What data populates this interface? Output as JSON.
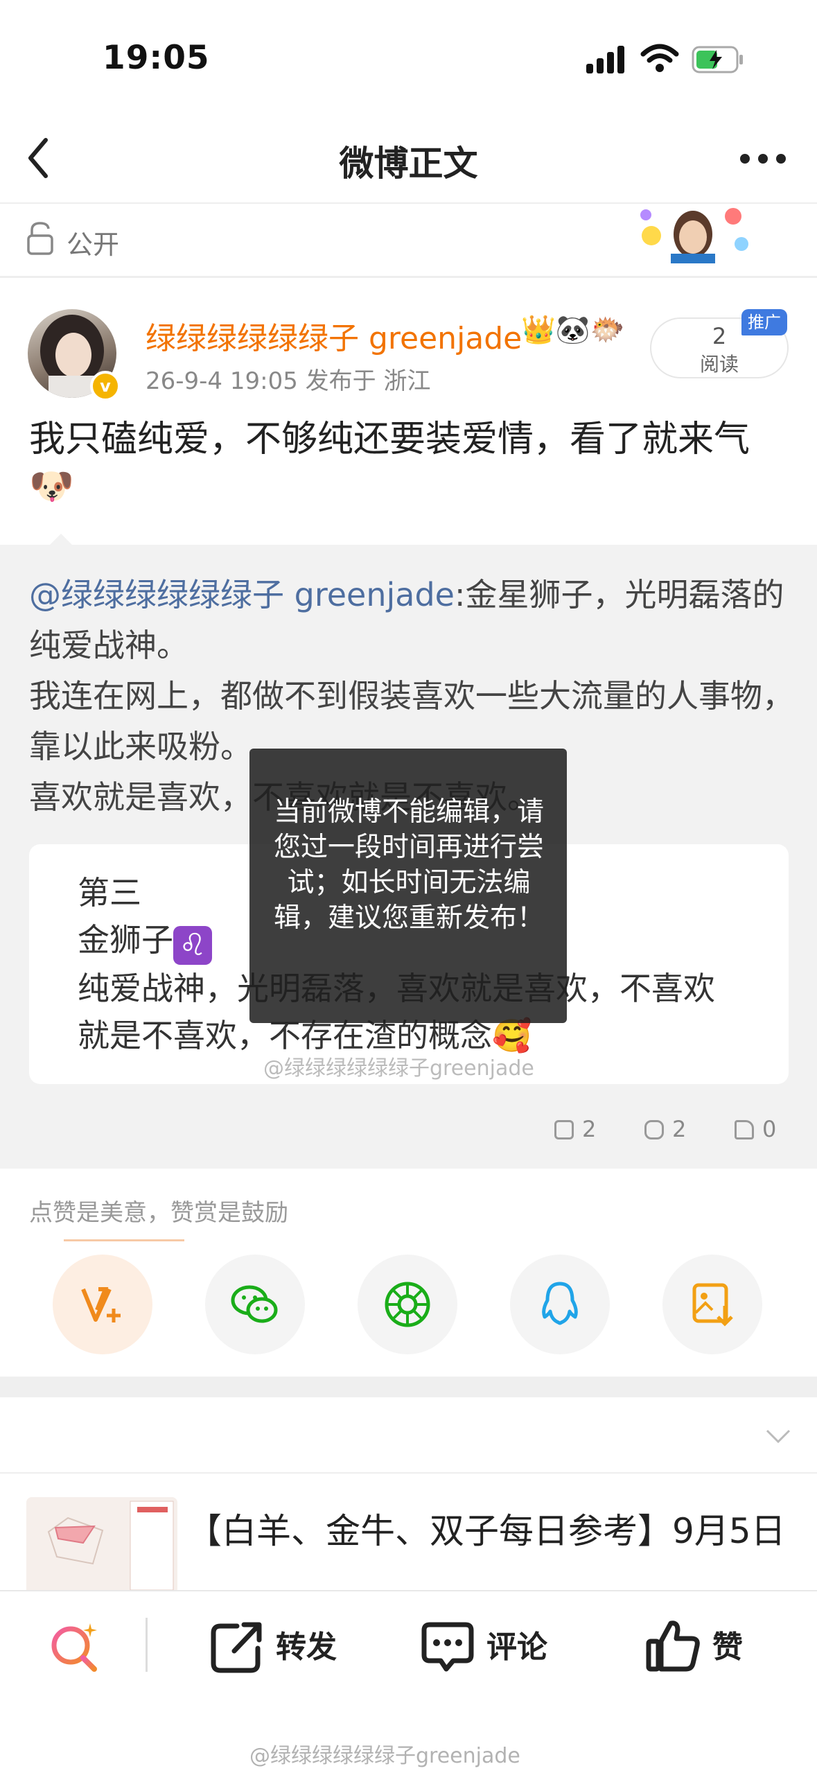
{
  "status_bar": {
    "time": "19:05"
  },
  "nav": {
    "title": "微博正文"
  },
  "visibility": {
    "label": "公开"
  },
  "post": {
    "username": "绿绿绿绿绿绿子 greenjade",
    "badge_emojis": "👑🐼🐡",
    "verified_badge": "v",
    "meta": "26-9-4 19:05   发布于 浙江",
    "read_count": "2",
    "read_label": "阅读",
    "promo_tag": "推广",
    "text": "我只磕纯爱，不够纯还要装爱情，看了就来气🐶"
  },
  "repost": {
    "mention": "@绿绿绿绿绿绿子 greenjade",
    "text_after_mention": ":金星狮子，光明磊落的纯爱战神。",
    "line2": "我连在网上，都做不到假装喜欢一些大流量的人事物，靠以此来吸粉。",
    "line3": "喜欢就是喜欢，不喜欢就是不喜欢。",
    "card": {
      "line1": "第三",
      "line2": "金狮子",
      "leo_symbol": "♌",
      "line3": "纯爱战神，光明磊落，喜欢就是喜欢，不喜欢就是不喜欢，不存在渣的概念🥰"
    },
    "watermark": "@绿绿绿绿绿绿子greenjade",
    "stats": {
      "reposts": "2",
      "comments": "2",
      "likes": "0"
    }
  },
  "toast": {
    "text": "当前微博不能编辑，请您过一段时间再进行尝试；如长时间无法编辑，建议您重新发布！"
  },
  "reward": {
    "label": "点赞是美意，赞赏是鼓励"
  },
  "share_icons": [
    "reward-v-icon",
    "wechat-icon",
    "moments-icon",
    "qq-icon",
    "save-image-icon"
  ],
  "recommend": {
    "title": "【白羊、金牛、双子每日参考】9月5日"
  },
  "bottom_bar": {
    "repost": "转发",
    "comment": "评论",
    "like": "赞",
    "watermark": "@绿绿绿绿绿绿子greenjade"
  },
  "colors": {
    "username": "#f27300",
    "mention": "#4e6ea0",
    "promo": "#3f7ae0"
  }
}
